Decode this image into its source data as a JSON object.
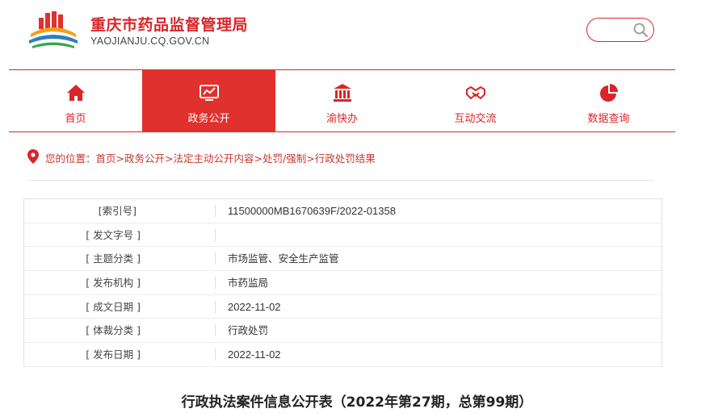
{
  "header": {
    "site_title": "重庆市药品监督管理局",
    "site_domain": "YAOJIANJU.CQ.GOV.CN",
    "search_placeholder": ""
  },
  "nav": [
    {
      "label": "首页",
      "icon": "home-icon",
      "active": false
    },
    {
      "label": "政务公开",
      "icon": "chart-icon",
      "active": true
    },
    {
      "label": "渝快办",
      "icon": "government-building-icon",
      "active": false
    },
    {
      "label": "互动交流",
      "icon": "handshake-icon",
      "active": false
    },
    {
      "label": "数据查询",
      "icon": "pie-chart-icon",
      "active": false
    }
  ],
  "breadcrumb": {
    "prefix": "您的位置：",
    "items": [
      "首页",
      "政务公开",
      "法定主动公开内容",
      "处罚/强制",
      "行政处罚结果"
    ]
  },
  "info": [
    {
      "key": "[索引号]",
      "value": "11500000MB1670639F/2022-01358"
    },
    {
      "key": "[ 发文字号 ]",
      "value": ""
    },
    {
      "key": "[ 主题分类 ]",
      "value": "市场监管、安全生产监管"
    },
    {
      "key": "[ 发布机构 ]",
      "value": "市药监局"
    },
    {
      "key": "[ 成文日期 ]",
      "value": "2022-11-02"
    },
    {
      "key": "[ 体裁分类 ]",
      "value": "行政处罚"
    },
    {
      "key": "[ 发布日期 ]",
      "value": "2022-11-02"
    }
  ],
  "document_title": "行政执法案件信息公开表（2022年第27期，总第99期）",
  "colors": {
    "brand_red": "#d8262a",
    "nav_active_bg": "#e0312d"
  }
}
